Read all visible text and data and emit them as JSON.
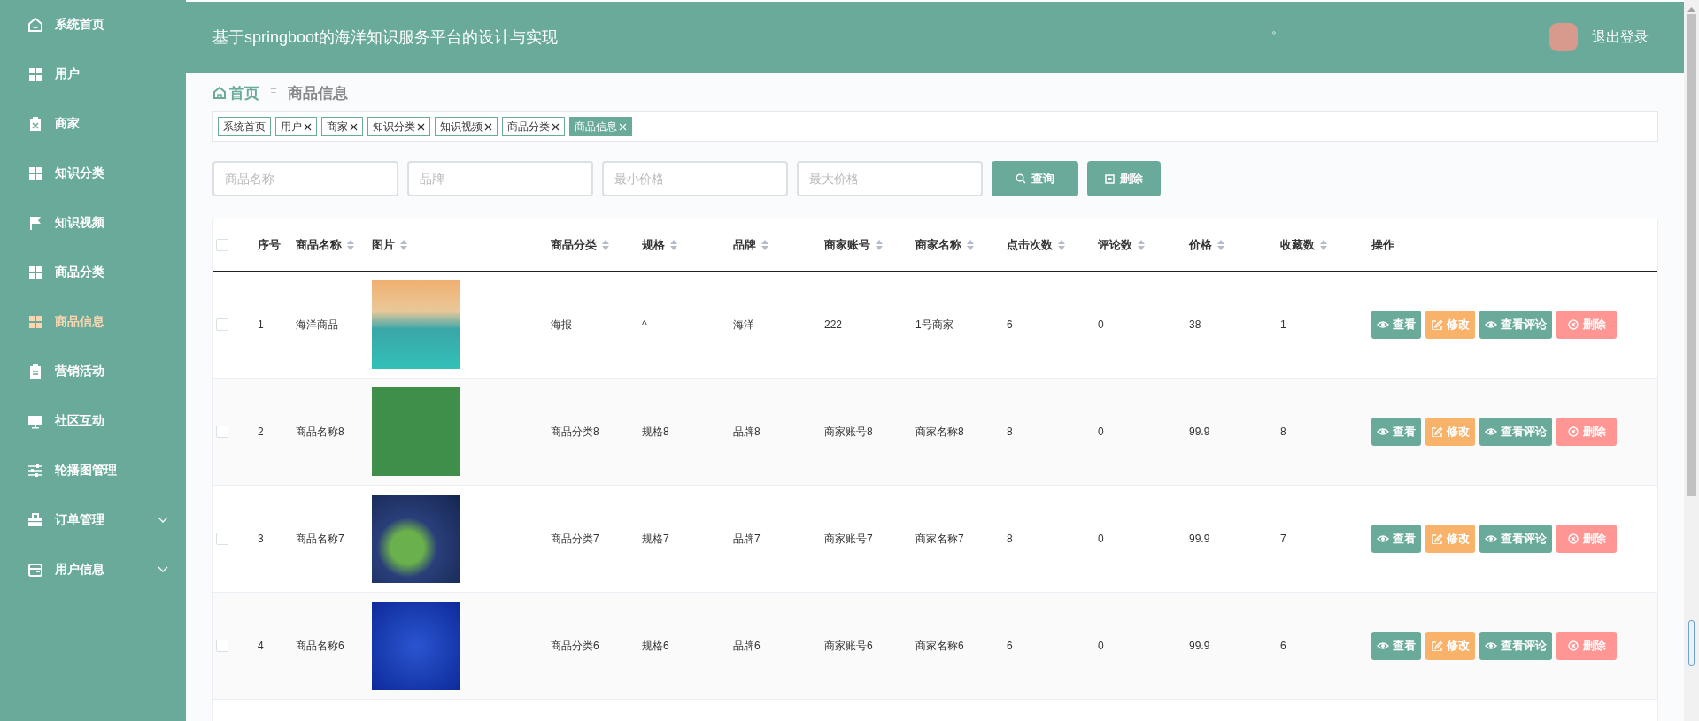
{
  "sidebar": {
    "items": [
      {
        "label": "系统首页",
        "selected": false,
        "expandable": false
      },
      {
        "label": "用户",
        "selected": false,
        "expandable": false
      },
      {
        "label": "商家",
        "selected": false,
        "expandable": false
      },
      {
        "label": "知识分类",
        "selected": false,
        "expandable": false
      },
      {
        "label": "知识视频",
        "selected": false,
        "expandable": false
      },
      {
        "label": "商品分类",
        "selected": false,
        "expandable": false
      },
      {
        "label": "商品信息",
        "selected": true,
        "expandable": false
      },
      {
        "label": "营销活动",
        "selected": false,
        "expandable": false
      },
      {
        "label": "社区互动",
        "selected": false,
        "expandable": false
      },
      {
        "label": "轮播图管理",
        "selected": false,
        "expandable": false
      },
      {
        "label": "订单管理",
        "selected": false,
        "expandable": true
      },
      {
        "label": "用户信息",
        "selected": false,
        "expandable": true
      }
    ]
  },
  "header": {
    "title": "基于springboot的海洋知识服务平台的设计与实现",
    "mark": "。",
    "logout": "退出登录"
  },
  "breadcrumb": {
    "home": "首页",
    "separator": "Ξ",
    "current": "商品信息"
  },
  "tags": [
    {
      "label": "系统首页",
      "closable": false,
      "selected": false
    },
    {
      "label": "用户",
      "closable": true,
      "selected": false
    },
    {
      "label": "商家",
      "closable": true,
      "selected": false
    },
    {
      "label": "知识分类",
      "closable": true,
      "selected": false
    },
    {
      "label": "知识视频",
      "closable": true,
      "selected": false
    },
    {
      "label": "商品分类",
      "closable": true,
      "selected": false
    },
    {
      "label": "商品信息",
      "closable": true,
      "selected": true
    }
  ],
  "search": {
    "fields": [
      {
        "placeholder": "商品名称"
      },
      {
        "placeholder": "品牌"
      },
      {
        "placeholder": "最小价格"
      },
      {
        "placeholder": "最大价格"
      }
    ],
    "query_button": "查询",
    "delete_button": "删除"
  },
  "table": {
    "select_all_checked": false,
    "columns": [
      {
        "label": "序号",
        "sortable": false
      },
      {
        "label": "商品名称",
        "sortable": true
      },
      {
        "label": "图片",
        "sortable": true
      },
      {
        "label": "商品分类",
        "sortable": true
      },
      {
        "label": "规格",
        "sortable": true
      },
      {
        "label": "品牌",
        "sortable": true
      },
      {
        "label": "商家账号",
        "sortable": true
      },
      {
        "label": "商家名称",
        "sortable": true
      },
      {
        "label": "点击次数",
        "sortable": true
      },
      {
        "label": "评论数",
        "sortable": true
      },
      {
        "label": "价格",
        "sortable": true
      },
      {
        "label": "收藏数",
        "sortable": true
      },
      {
        "label": "操作",
        "sortable": false
      }
    ],
    "rows": [
      {
        "checked": false,
        "cells": [
          "1",
          "海洋商品",
          "",
          "海报",
          "^",
          "海洋",
          "222",
          "1号商家",
          "6",
          "0",
          "38",
          "1"
        ],
        "actions": [
          {
            "label": "查看",
            "kind": "view"
          },
          {
            "label": "修改",
            "kind": "edit"
          },
          {
            "label": "查看评论",
            "kind": "comments"
          },
          {
            "label": "删除",
            "kind": "delete"
          }
        ]
      },
      {
        "checked": false,
        "cells": [
          "2",
          "商品名称8",
          "",
          "商品分类8",
          "规格8",
          "品牌8",
          "商家账号8",
          "商家名称8",
          "8",
          "0",
          "99.9",
          "8"
        ],
        "actions": [
          {
            "label": "查看",
            "kind": "view"
          },
          {
            "label": "修改",
            "kind": "edit"
          },
          {
            "label": "查看评论",
            "kind": "comments"
          },
          {
            "label": "删除",
            "kind": "delete"
          }
        ]
      },
      {
        "checked": false,
        "cells": [
          "3",
          "商品名称7",
          "",
          "商品分类7",
          "规格7",
          "品牌7",
          "商家账号7",
          "商家名称7",
          "8",
          "0",
          "99.9",
          "7"
        ],
        "actions": [
          {
            "label": "查看",
            "kind": "view"
          },
          {
            "label": "修改",
            "kind": "edit"
          },
          {
            "label": "查看评论",
            "kind": "comments"
          },
          {
            "label": "删除",
            "kind": "delete"
          }
        ]
      },
      {
        "checked": false,
        "cells": [
          "4",
          "商品名称6",
          "",
          "商品分类6",
          "规格6",
          "品牌6",
          "商家账号6",
          "商家名称6",
          "6",
          "0",
          "99.9",
          "6"
        ],
        "actions": [
          {
            "label": "查看",
            "kind": "view"
          },
          {
            "label": "修改",
            "kind": "edit"
          },
          {
            "label": "查看评论",
            "kind": "comments"
          },
          {
            "label": "删除",
            "kind": "delete"
          }
        ]
      }
    ]
  }
}
